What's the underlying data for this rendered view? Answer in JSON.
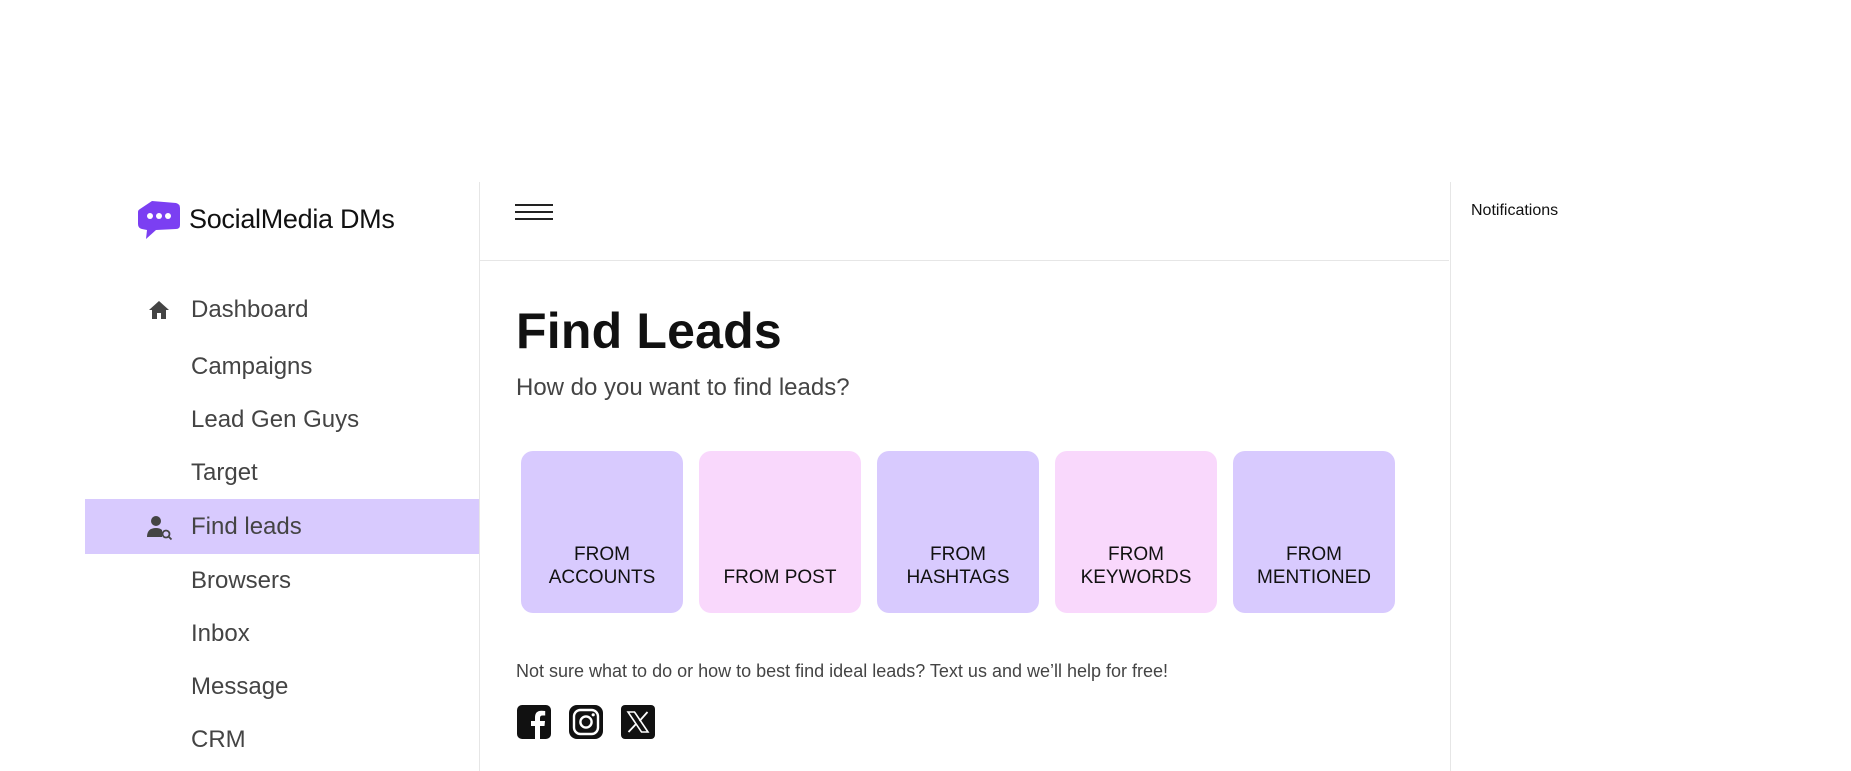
{
  "brand": {
    "name": "SocialMedia DMs",
    "accent": "#7b3ff2"
  },
  "sidebar": {
    "items": [
      {
        "label": "Dashboard",
        "icon": "home-icon"
      },
      {
        "label": "Campaigns"
      },
      {
        "label": "Lead Gen Guys"
      },
      {
        "label": "Target"
      },
      {
        "label": "Find leads",
        "icon": "user-search-icon",
        "active": true
      },
      {
        "label": "Browsers"
      },
      {
        "label": "Inbox"
      },
      {
        "label": "Message"
      },
      {
        "label": "CRM"
      }
    ],
    "active_color": "#d8cafe"
  },
  "main": {
    "title": "Find Leads",
    "subtitle": "How do you want to find leads?",
    "cards": [
      {
        "label": "FROM\nACCOUNTS",
        "color": "#d8cafe"
      },
      {
        "label": "FROM POST",
        "color": "#f9d8fc"
      },
      {
        "label": "FROM\nHASHTAGS",
        "color": "#d8cafe"
      },
      {
        "label": "FROM\nKEYWORDS",
        "color": "#f9d8fc"
      },
      {
        "label": "FROM\nMENTIONED",
        "color": "#d8cafe"
      }
    ],
    "help_text": "Not sure what to do or how to best find ideal leads? Text us and we’ll help for free!",
    "socials": [
      "facebook-icon",
      "instagram-icon",
      "x-icon"
    ]
  },
  "notifications": {
    "title": "Notifications"
  }
}
